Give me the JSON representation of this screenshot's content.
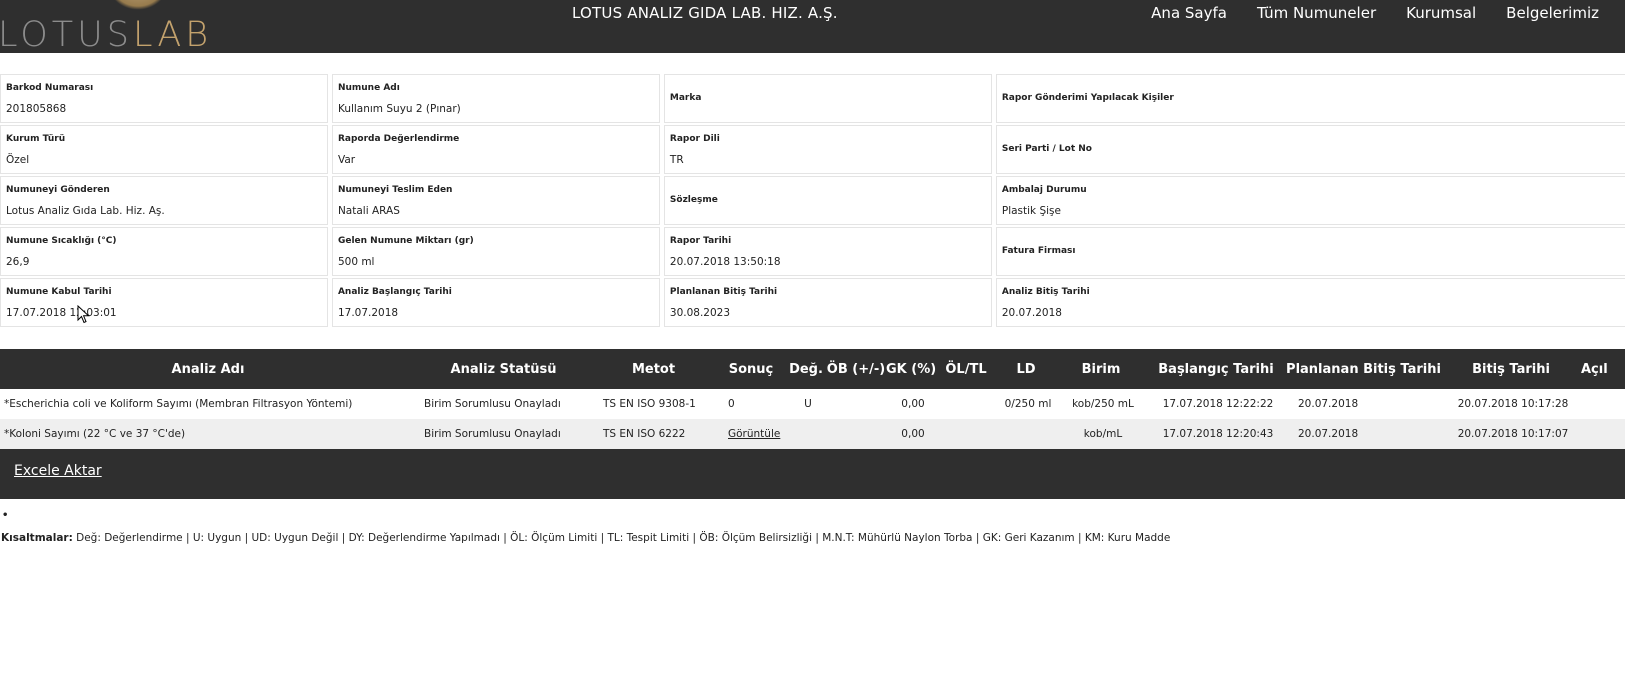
{
  "header": {
    "logo_part1": "LOTUS",
    "logo_part2": "LAB",
    "title": "LOTUS ANALIZ GIDA LAB. HIZ. A.Ş.",
    "nav": [
      "Ana Sayfa",
      "Tüm Numuneler",
      "Kurumsal",
      "Belgelerimiz"
    ],
    "bg_color": "#2f2f2f",
    "logo_accent_color": "#c3a26d"
  },
  "info": {
    "rows": [
      [
        {
          "label": "Barkod Numarası",
          "value": "201805868"
        },
        {
          "label": "Numune Adı",
          "value": "Kullanım Suyu 2 (Pınar)"
        },
        {
          "label": "Marka",
          "value": ""
        },
        {
          "label": "Rapor Gönderimi Yapılacak Kişiler",
          "value": ""
        }
      ],
      [
        {
          "label": "Kurum Türü",
          "value": "Özel"
        },
        {
          "label": "Raporda Değerlendirme",
          "value": "Var"
        },
        {
          "label": "Rapor Dili",
          "value": "TR"
        },
        {
          "label": "Seri Parti / Lot No",
          "value": ""
        }
      ],
      [
        {
          "label": "Numuneyi Gönderen",
          "value": "Lotus Analiz Gıda Lab. Hiz. Aş."
        },
        {
          "label": "Numuneyi Teslim Eden",
          "value": "Natali ARAS"
        },
        {
          "label": "Sözleşme",
          "value": ""
        },
        {
          "label": "Ambalaj Durumu",
          "value": "Plastik Şişe"
        }
      ],
      [
        {
          "label": "Numune Sıcaklığı (°C)",
          "value": "26,9"
        },
        {
          "label": "Gelen Numune Miktarı (gr)",
          "value": "500 ml"
        },
        {
          "label": "Rapor Tarihi",
          "value": "20.07.2018 13:50:18"
        },
        {
          "label": "Fatura Firması",
          "value": ""
        }
      ],
      [
        {
          "label": "Numune Kabul Tarihi",
          "value": "17.07.2018 12:03:01"
        },
        {
          "label": "Analiz Başlangıç Tarihi",
          "value": "17.07.2018"
        },
        {
          "label": "Planlanan Bitiş Tarihi",
          "value": "30.08.2023"
        },
        {
          "label": "Analiz Bitiş Tarihi",
          "value": "20.07.2018"
        }
      ]
    ]
  },
  "analysis": {
    "columns": [
      "Analiz Adı",
      "Analiz Statüsü",
      "Metot",
      "Sonuç",
      "Değ.",
      "ÖB (+/-)",
      "GK (%)",
      "ÖL/TL",
      "LD",
      "Birim",
      "Başlangıç Tarihi",
      "Planlanan Bitiş Tarihi",
      "Bitiş Tarihi",
      "Açıl"
    ],
    "rows": [
      [
        "*Escherichia coli ve Koliform Sayımı (Membran Filtrasyon Yöntemi)",
        "Birim Sorumlusu Onayladı",
        "TS EN ISO 9308-1",
        "0",
        "U",
        "",
        "0,00",
        "",
        "0/250 ml",
        "kob/250 mL",
        "17.07.2018 12:22:22",
        "20.07.2018",
        "20.07.2018 10:17:28",
        ""
      ],
      [
        "*Koloni Sayımı (22 °C ve 37 °C'de)",
        "Birim Sorumlusu Onayladı",
        "TS EN ISO 6222",
        "Görüntüle",
        "",
        "",
        "0,00",
        "",
        "",
        "kob/mL",
        "17.07.2018 12:20:43",
        "20.07.2018",
        "20.07.2018 10:17:07",
        ""
      ]
    ],
    "export_label": "Excele Aktar"
  },
  "footnote": {
    "marker": "•",
    "title": "Kısaltmalar:",
    "text": " Değ: Değerlendirme | U: Uygun | UD: Uygun Değil | DY: Değerlendirme Yapılmadı | ÖL: Ölçüm Limiti | TL: Tespit Limiti | ÖB: Ölçüm Belirsizliği | M.N.T: Mühürlü Naylon Torba | GK: Geri Kazanım | KM: Kuru Madde"
  }
}
